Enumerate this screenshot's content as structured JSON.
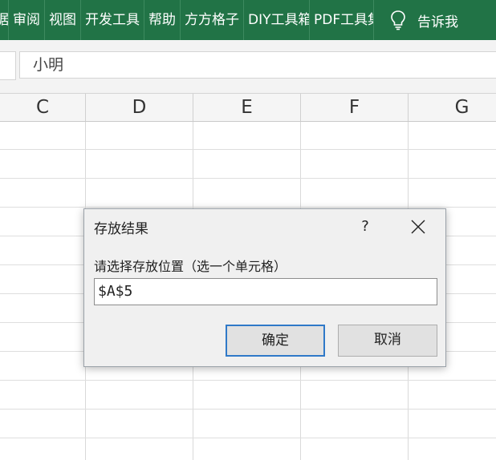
{
  "ribbon": {
    "tabs": [
      "据",
      "审阅",
      "视图",
      "开发工具",
      "帮助",
      "方方格子",
      "DIY工具箱",
      "PDF工具集"
    ],
    "tell_me": "告诉我"
  },
  "formula_bar": {
    "value": "小明"
  },
  "columns": [
    "C",
    "D",
    "E",
    "F",
    "G"
  ],
  "dialog": {
    "title": "存放结果",
    "help": "?",
    "prompt": "请选择存放位置（选一个单元格）",
    "input_value": "$A$5",
    "ok_label": "确定",
    "cancel_label": "取消"
  },
  "colors": {
    "ribbon": "#217346",
    "accent": "#2f79c8"
  }
}
